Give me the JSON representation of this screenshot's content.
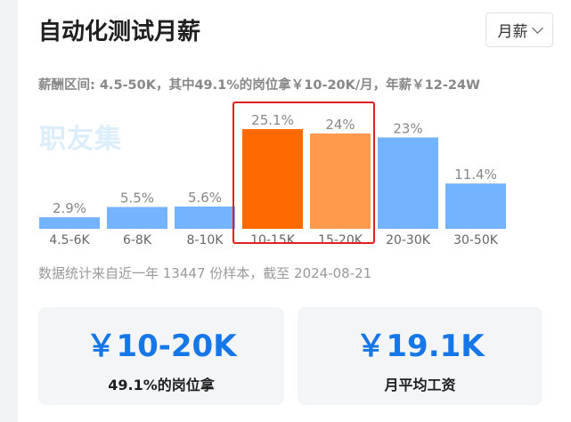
{
  "header": {
    "title": "自动化测试月薪",
    "mode_select": "月薪"
  },
  "summary": "薪酬区间: 4.5-50K，其中49.1%的岗位拿￥10-20K/月，年薪￥12-24W",
  "watermark": "职友集",
  "chart_data": {
    "type": "bar",
    "categories": [
      "4.5-6K",
      "6-8K",
      "8-10K",
      "10-15K",
      "15-20K",
      "20-30K",
      "30-50K"
    ],
    "values": [
      2.9,
      5.5,
      5.6,
      25.1,
      24,
      23,
      11.4
    ],
    "value_labels": [
      "2.9%",
      "5.5%",
      "5.6%",
      "25.1%",
      "24%",
      "23%",
      "11.4%"
    ],
    "unit": "%",
    "highlighted_categories": [
      "10-15K",
      "15-20K"
    ],
    "colors": {
      "default": "#74b3ff",
      "highlight_primary": "#ff6a00",
      "highlight_secondary": "#ff9a4d",
      "highlight_border": "#e01f1f"
    },
    "ylim": [
      0,
      25.1
    ],
    "grid": false,
    "legend": "none"
  },
  "note": "数据统计来自近一年 13447 份样本，截至 2024-08-21",
  "cards": {
    "left": {
      "value": "￥10-20K",
      "label": "49.1%的岗位拿"
    },
    "right": {
      "value": "￥19.1K",
      "label": "月平均工资"
    }
  }
}
